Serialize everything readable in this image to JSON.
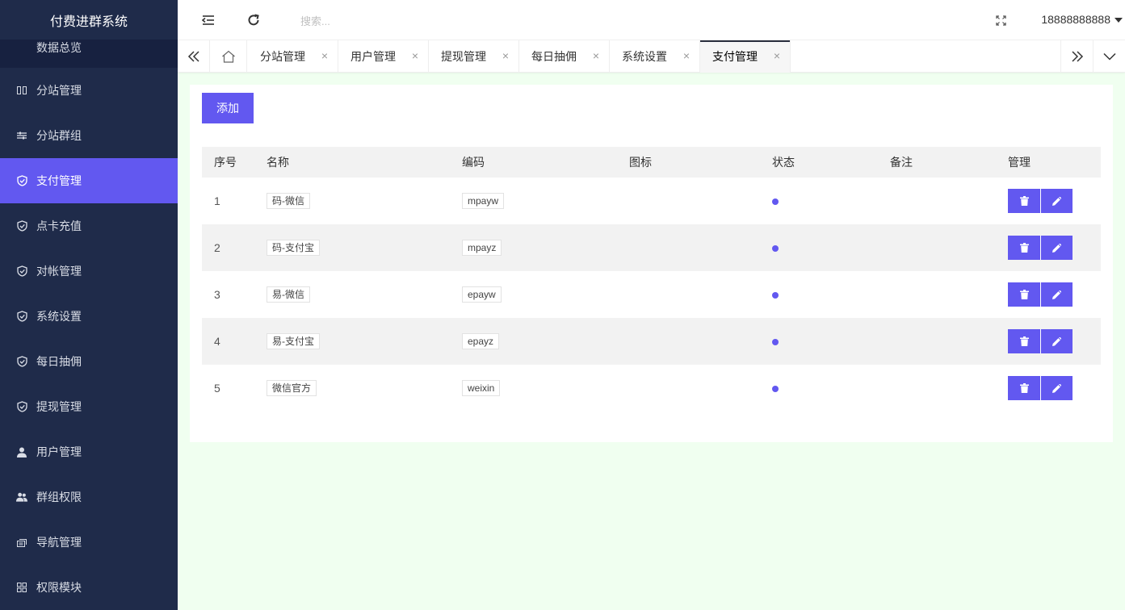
{
  "app": {
    "title": "付费进群系统"
  },
  "sidebar": {
    "sub_item": "数据总览",
    "items": [
      {
        "label": "分站管理",
        "icon": "columns-icon"
      },
      {
        "label": "分站群组",
        "icon": "sliders-icon"
      },
      {
        "label": "支付管理",
        "icon": "shield-check-icon",
        "active": true
      },
      {
        "label": "点卡充值",
        "icon": "shield-check-icon"
      },
      {
        "label": "对帐管理",
        "icon": "shield-check-icon"
      },
      {
        "label": "系统设置",
        "icon": "shield-check-icon"
      },
      {
        "label": "每日抽佣",
        "icon": "shield-check-icon"
      },
      {
        "label": "提现管理",
        "icon": "shield-check-icon"
      },
      {
        "label": "用户管理",
        "icon": "user-icon"
      },
      {
        "label": "群组权限",
        "icon": "users-icon"
      },
      {
        "label": "导航管理",
        "icon": "nav-icon"
      },
      {
        "label": "权限模块",
        "icon": "grid-icon"
      }
    ]
  },
  "header": {
    "search_placeholder": "搜索...",
    "username": "18888888888"
  },
  "tabs": {
    "items": [
      {
        "label": "分站管理",
        "close": "×"
      },
      {
        "label": "用户管理",
        "close": "×"
      },
      {
        "label": "提现管理",
        "close": "×"
      },
      {
        "label": "每日抽佣",
        "close": "×"
      },
      {
        "label": "系统设置",
        "close": "×"
      },
      {
        "label": "支付管理",
        "close": "×",
        "active": true
      }
    ]
  },
  "main": {
    "add_label": "添加",
    "columns": [
      "序号",
      "名称",
      "编码",
      "图标",
      "状态",
      "备注",
      "管理"
    ],
    "rows": [
      {
        "no": "1",
        "name": "码-微信",
        "code": "mpayw",
        "icon": "",
        "remark": ""
      },
      {
        "no": "2",
        "name": "码-支付宝",
        "code": "mpayz",
        "icon": "",
        "remark": ""
      },
      {
        "no": "3",
        "name": "易-微信",
        "code": "epayw",
        "icon": "",
        "remark": ""
      },
      {
        "no": "4",
        "name": "易-支付宝",
        "code": "epayz",
        "icon": "",
        "remark": ""
      },
      {
        "no": "5",
        "name": "微信官方",
        "code": "weixin",
        "icon": "",
        "remark": ""
      }
    ]
  },
  "colors": {
    "accent": "#6258f0",
    "sidebar_bg": "#1f2b4a",
    "content_bg": "#f0fff0"
  }
}
